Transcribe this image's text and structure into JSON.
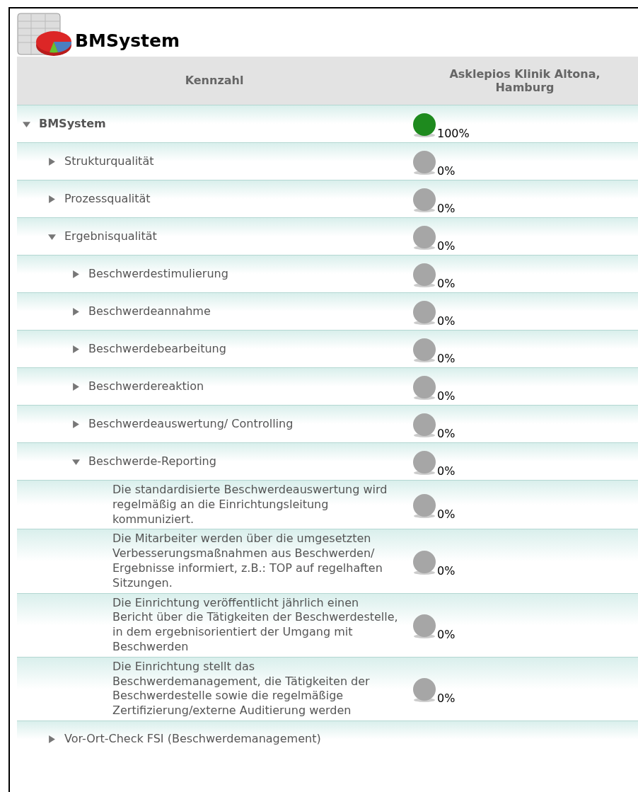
{
  "title": "BMSystem",
  "columns": [
    "Kennzahl",
    "Asklepios Klinik Altona, Hamburg"
  ],
  "rows": [
    {
      "label": "BMSystem",
      "expanded": true,
      "bold": true,
      "color": "#1e8a1e",
      "value": "100%",
      "children": [
        {
          "label": "Strukturqualität",
          "expanded": false,
          "color": "#a6a6a6",
          "value": "0%"
        },
        {
          "label": "Prozessqualität",
          "expanded": false,
          "color": "#a6a6a6",
          "value": "0%"
        },
        {
          "label": "Ergebnisqualität",
          "expanded": true,
          "color": "#a6a6a6",
          "value": "0%",
          "children": [
            {
              "label": "Beschwerdestimulierung",
              "expanded": false,
              "color": "#a6a6a6",
              "value": "0%"
            },
            {
              "label": "Beschwerdeannahme",
              "expanded": false,
              "color": "#a6a6a6",
              "value": "0%"
            },
            {
              "label": "Beschwerdebearbeitung",
              "expanded": false,
              "color": "#a6a6a6",
              "value": "0%"
            },
            {
              "label": "Beschwerdereaktion",
              "expanded": false,
              "color": "#a6a6a6",
              "value": "0%"
            },
            {
              "label": "Beschwerdeauswertung/ Controlling",
              "expanded": false,
              "color": "#a6a6a6",
              "value": "0%"
            },
            {
              "label": "Beschwerde-Reporting",
              "expanded": true,
              "color": "#a6a6a6",
              "value": "0%",
              "children": [
                {
                  "label": "Die standardisierte Beschwerdeauswertung wird regelmäßig an die Einrichtungsleitung kommuniziert.",
                  "color": "#a6a6a6",
                  "value": "0%"
                },
                {
                  "label": "Die Mitarbeiter werden über die umgesetzten Verbesserungsmaßnahmen aus Beschwerden/ Ergebnisse informiert, z.B.: TOP auf regelhaften Sitzungen.",
                  "color": "#a6a6a6",
                  "value": "0%"
                },
                {
                  "label": "Die Einrichtung veröffentlicht jährlich einen Bericht über die Tätigkeiten der Beschwerdestelle, in dem ergebnisorientiert der Umgang mit Beschwerden",
                  "color": "#a6a6a6",
                  "value": "0%"
                },
                {
                  "label": "Die Einrichtung stellt das Beschwerdemanagement, die Tätigkeiten der Beschwerdestelle sowie die regelmäßige Zertifizierung/externe Auditierung werden",
                  "color": "#a6a6a6",
                  "value": "0%"
                }
              ]
            }
          ]
        },
        {
          "label": "Vor-Ort-Check FSI (Beschwerdemanagement)",
          "expanded": false
        }
      ]
    }
  ]
}
